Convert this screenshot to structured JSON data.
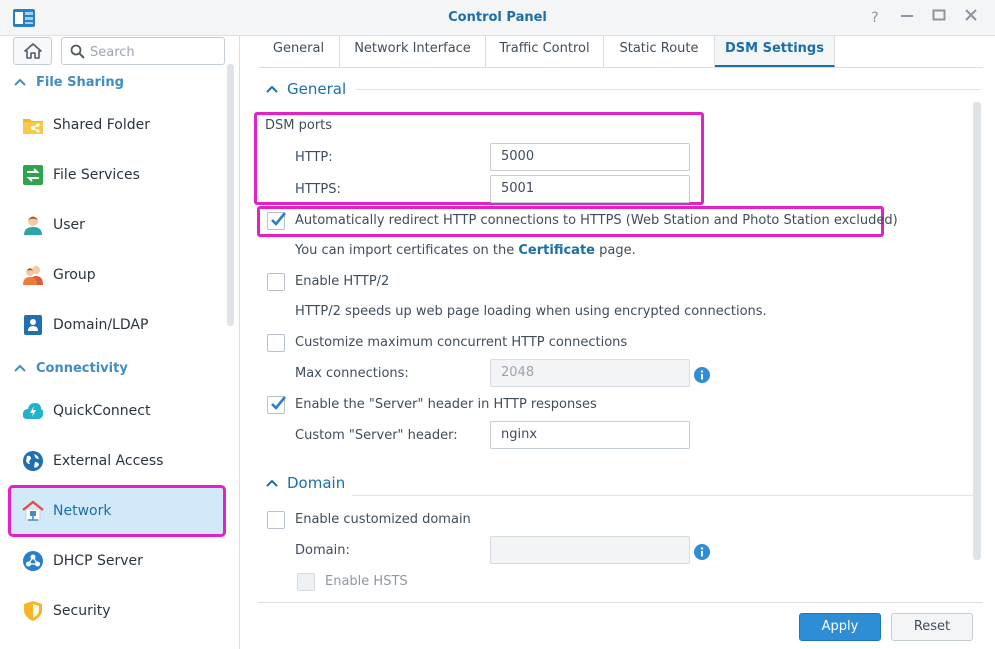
{
  "window": {
    "title": "Control Panel",
    "controls": [
      "help-icon",
      "minimize-icon",
      "maximize-icon",
      "close-icon"
    ]
  },
  "sidebar": {
    "search_placeholder": "Search",
    "sections": [
      {
        "label": "File Sharing",
        "items": [
          {
            "label": "Shared Folder",
            "icon": "shared-folder-icon"
          },
          {
            "label": "File Services",
            "icon": "file-services-icon"
          },
          {
            "label": "User",
            "icon": "user-icon"
          },
          {
            "label": "Group",
            "icon": "group-icon"
          },
          {
            "label": "Domain/LDAP",
            "icon": "domain-ldap-icon"
          }
        ]
      },
      {
        "label": "Connectivity",
        "items": [
          {
            "label": "QuickConnect",
            "icon": "quickconnect-icon"
          },
          {
            "label": "External Access",
            "icon": "external-access-icon"
          },
          {
            "label": "Network",
            "icon": "network-icon",
            "active": true
          },
          {
            "label": "DHCP Server",
            "icon": "dhcp-server-icon"
          },
          {
            "label": "Security",
            "icon": "security-icon"
          }
        ]
      }
    ]
  },
  "tabs": [
    {
      "label": "General"
    },
    {
      "label": "Network Interface"
    },
    {
      "label": "Traffic Control"
    },
    {
      "label": "Static Route"
    },
    {
      "label": "DSM Settings",
      "active": true
    }
  ],
  "general": {
    "title": "General",
    "dsm_ports_label": "DSM ports",
    "http_label": "HTTP:",
    "http_value": "5000",
    "https_label": "HTTPS:",
    "https_value": "5001",
    "redirect": {
      "label": "Automatically redirect HTTP connections to HTTPS (Web Station and Photo Station excluded)",
      "checked": true
    },
    "cert_note_prefix": "You can import certificates on the",
    "cert_note_link": "Certificate",
    "cert_note_suffix": "page.",
    "http2": {
      "label": "Enable HTTP/2",
      "checked": false
    },
    "http2_note": "HTTP/2 speeds up web page loading when using encrypted connections.",
    "max_conn": {
      "label": "Customize maximum concurrent HTTP connections",
      "checked": false
    },
    "max_conn_label": "Max connections:",
    "max_conn_value": "2048",
    "server_header": {
      "label": "Enable the \"Server\" header in HTTP responses",
      "checked": true
    },
    "custom_header_label": "Custom \"Server\" header:",
    "custom_header_value": "nginx"
  },
  "domain": {
    "title": "Domain",
    "custom_domain": {
      "label": "Enable customized domain",
      "checked": false
    },
    "domain_label": "Domain:",
    "domain_value": "",
    "hsts": {
      "label": "Enable HSTS",
      "checked": false,
      "disabled": true
    }
  },
  "footer": {
    "apply_label": "Apply",
    "reset_label": "Reset"
  },
  "colors": {
    "accent": "#1a6fa9",
    "highlight": "#e420c8",
    "apply_button": "#2d8ed6"
  }
}
